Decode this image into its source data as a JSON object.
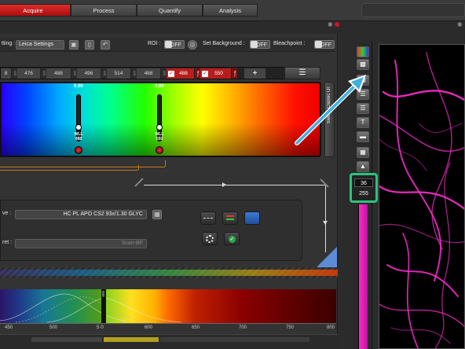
{
  "workflow_tabs": [
    {
      "label": "Acquire",
      "active": true
    },
    {
      "label": "Process",
      "active": false
    },
    {
      "label": "Quantify",
      "active": false
    },
    {
      "label": "Analysis",
      "active": false
    }
  ],
  "settings_row": {
    "setting_label_partial": "tting :",
    "setting_value": "Leica Settings",
    "roi_label": "ROI :",
    "roi_toggle": "OFF",
    "background_label": "Set Background :",
    "background_toggle": "OFF",
    "bleachpoint_label": "Bleachpoint :",
    "bleachpoint_toggle": "OFF"
  },
  "laser_lines": [
    {
      "wavelength": "8",
      "checked": false
    },
    {
      "wavelength": "476",
      "checked": false
    },
    {
      "wavelength": "488",
      "checked": false
    },
    {
      "wavelength": "496",
      "checked": false
    },
    {
      "wavelength": "514",
      "checked": false
    },
    {
      "wavelength": "488",
      "checked": true
    },
    {
      "wavelength": "550",
      "checked": true
    }
  ],
  "vis_label": "VIS",
  "wll_label": "WLL",
  "add_label": "+",
  "spectrum": {
    "slider_1": {
      "percent": "0.00",
      "source": "WLL",
      "wavelength": "488"
    },
    "slider_2": {
      "percent": "4.00",
      "source": "WLL",
      "wavelength": "550"
    },
    "switch_label": "Switch Classic UI"
  },
  "objective_panel": {
    "objective_label_partial": "ve :",
    "objective_value": "HC PL APO CS2   93x/1.30 GLYC",
    "preset_label_partial": "ret :",
    "preset_value": "Scan-BF"
  },
  "emission": {
    "marker_label": "550",
    "axis_ticks": [
      "450",
      "500",
      "5·0",
      "600",
      "650",
      "700",
      "750",
      "800"
    ]
  },
  "intensity": {
    "value": "36",
    "max": "255"
  },
  "colors": {
    "accent_red": "#c41a1a",
    "highlight_green": "#2ec27e",
    "annotation_arrow": "#3db0e0",
    "image_magenta": "#ff2ed2"
  },
  "icons": [
    "save-icon",
    "trash-icon",
    "undo-icon",
    "roi-target-icon",
    "list-menu-icon",
    "settings-gear-icon",
    "palette-icon",
    "lut-icon",
    "histogram-icon",
    "text-icon",
    "layer-icon",
    "mountains-icon",
    "film-reel-icon",
    "checkmark-icon"
  ]
}
